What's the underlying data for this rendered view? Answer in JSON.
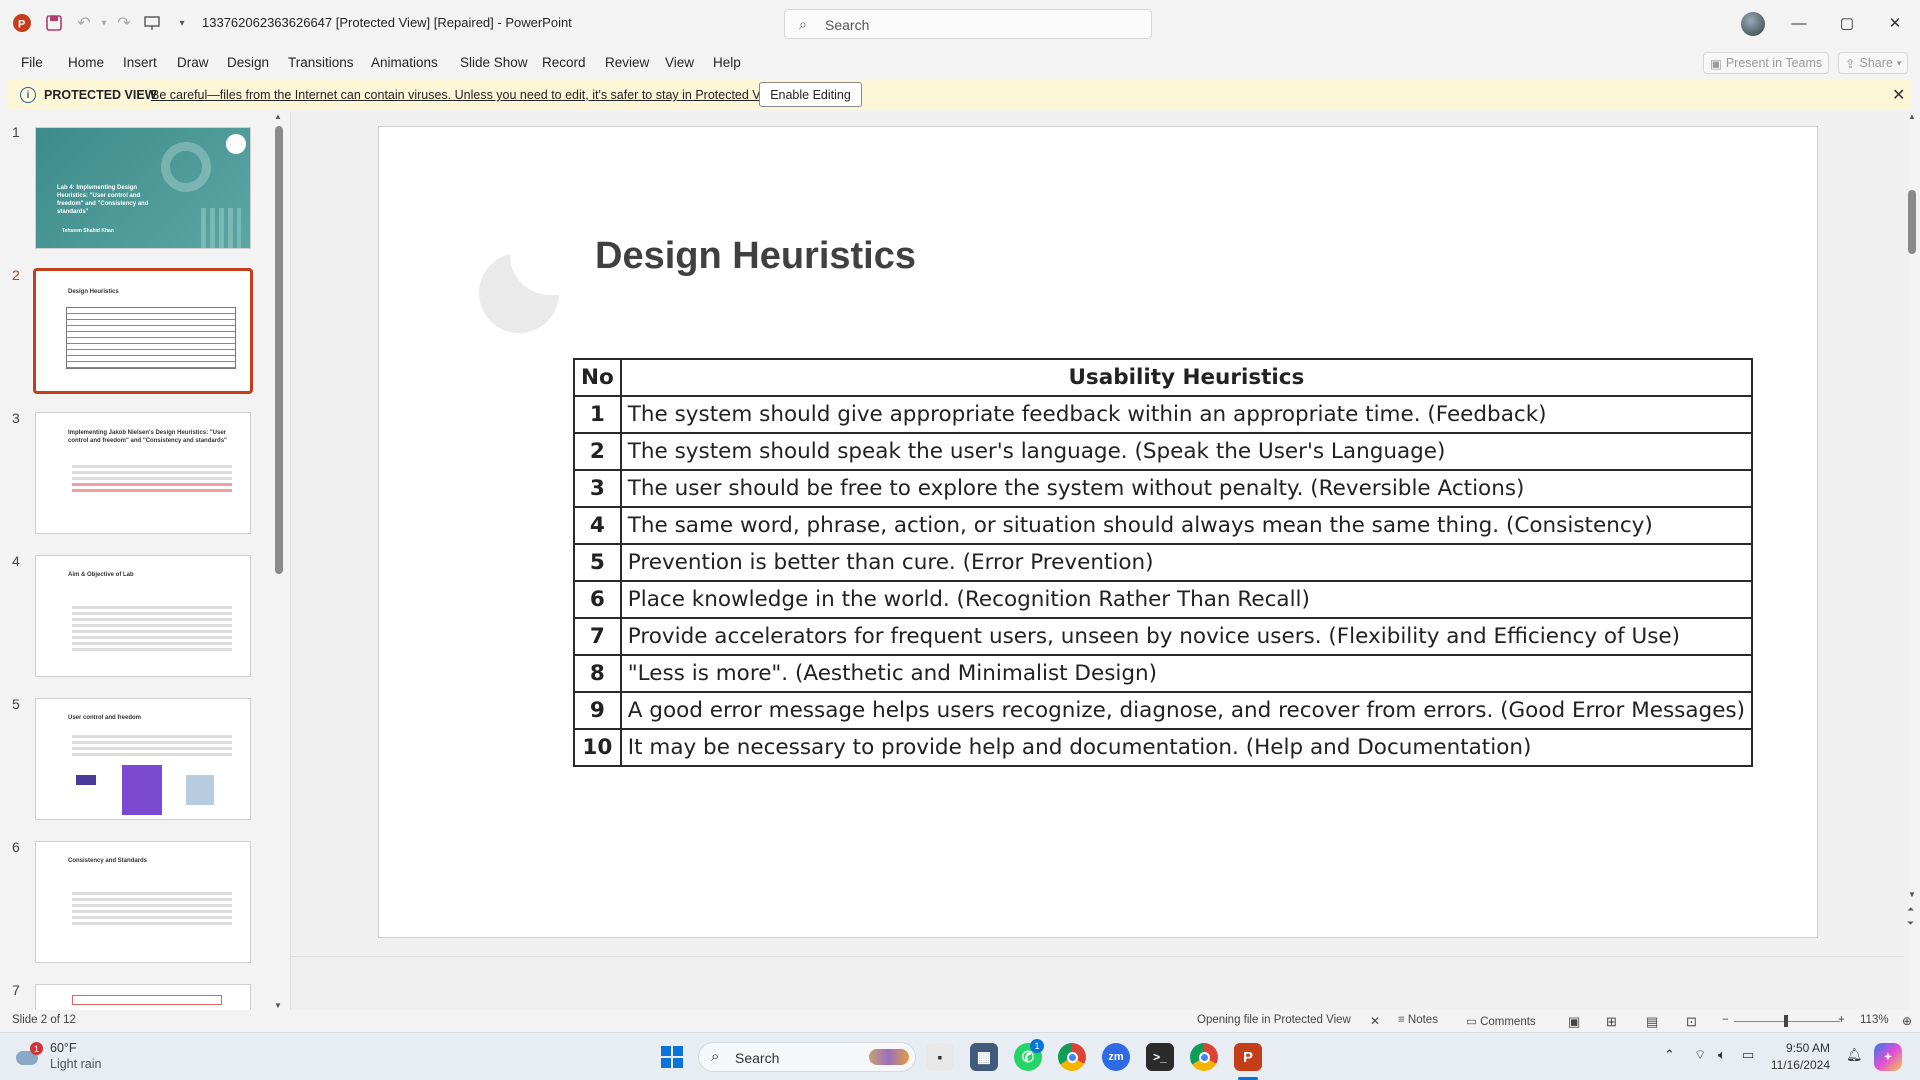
{
  "app": {
    "title": "133762062363626647 [Protected View] [Repaired]  -  PowerPoint",
    "search_placeholder": "Search",
    "brand_color": "#c43e1c"
  },
  "window_controls": {
    "minimize": "—",
    "maximize": "▢",
    "close": "✕"
  },
  "menu": [
    "File",
    "Home",
    "Insert",
    "Draw",
    "Design",
    "Transitions",
    "Animations",
    "Slide Show",
    "Record",
    "Review",
    "View",
    "Help"
  ],
  "ribbon_right": {
    "present": "Present in Teams",
    "share": "Share"
  },
  "protected_view": {
    "title": "PROTECTED VIEW",
    "message": "Be careful—files from the Internet can contain viruses. Unless you need to edit, it's safer to stay in Protected View.",
    "button": "Enable Editing"
  },
  "thumbnails": [
    {
      "num": "1",
      "title": "Lab 4: Implementing Design Heuristics: \"User control and freedom\" and \"Consistency and standards\"",
      "sub": "Tehseen Shahid Khan"
    },
    {
      "num": "2",
      "title": "Design Heuristics"
    },
    {
      "num": "3",
      "title": "Implementing Jakob Nielsen's Design Heuristics: \"User control and freedom\" and \"Consistency and standards\""
    },
    {
      "num": "4",
      "title": "Aim & Objective of Lab"
    },
    {
      "num": "5",
      "title": "User control and freedom"
    },
    {
      "num": "6",
      "title": "Consistency and Standards"
    },
    {
      "num": "7",
      "title": ""
    }
  ],
  "slide": {
    "title": "Design Heuristics",
    "table": {
      "headers": [
        "No",
        "Usability Heuristics"
      ],
      "rows": [
        [
          "1",
          "The system should give appropriate feedback within an appropriate time. (Feedback)"
        ],
        [
          "2",
          "The system should speak the user's language. (Speak the User's Language)"
        ],
        [
          "3",
          "The user should be free to explore the system without penalty. (Reversible Actions)"
        ],
        [
          "4",
          "The same word, phrase, action, or situation should always mean the same thing. (Consistency)"
        ],
        [
          "5",
          "Prevention is better than cure. (Error Prevention)"
        ],
        [
          "6",
          "Place knowledge in the world. (Recognition Rather Than Recall)"
        ],
        [
          "7",
          "Provide accelerators for frequent users, unseen by novice users. (Flexibility and Efficiency of Use)"
        ],
        [
          "8",
          "\"Less is more\". (Aesthetic and Minimalist Design)"
        ],
        [
          "9",
          "A good error message helps users recognize, diagnose, and recover from errors. (Good Error Messages)"
        ],
        [
          "10",
          "It may be necessary to provide help and documentation. (Help and Documentation)"
        ]
      ]
    }
  },
  "status": {
    "slide": "Slide 2 of 12",
    "protected": "Opening file in Protected View",
    "notes": "Notes",
    "comments": "Comments",
    "zoom": "113%"
  },
  "taskbar": {
    "weather_temp": "60°F",
    "weather_desc": "Light rain",
    "weather_badge": "1",
    "search": "Search",
    "whatsapp_badge": "1",
    "time": "9:50 AM",
    "date": "11/16/2024"
  }
}
